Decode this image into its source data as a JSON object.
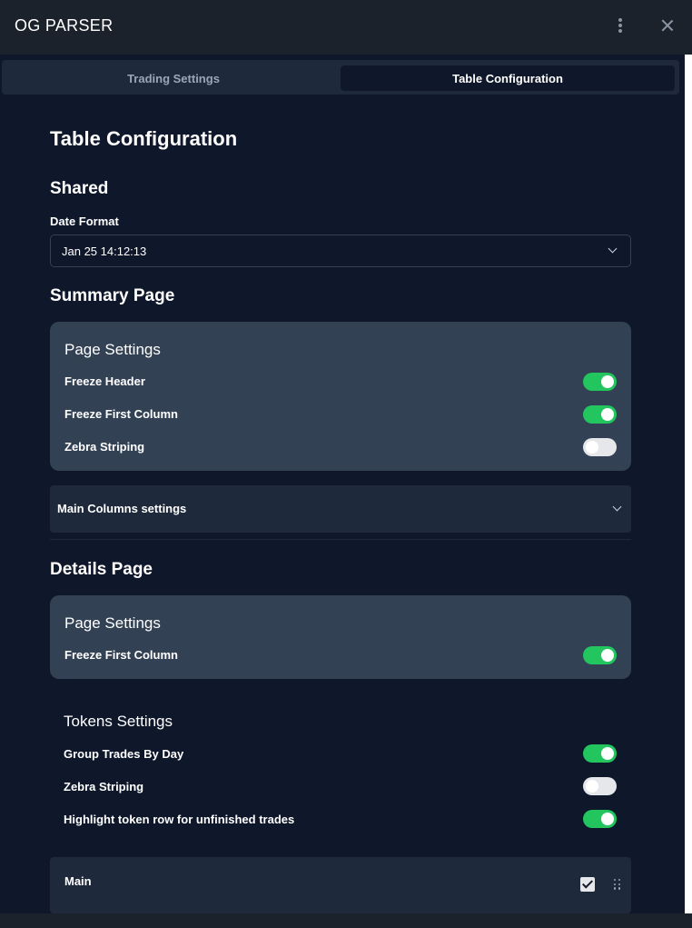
{
  "window": {
    "title": "OG PARSER"
  },
  "tabs": [
    {
      "label": "Trading Settings",
      "active": false
    },
    {
      "label": "Table Configuration",
      "active": true
    }
  ],
  "page": {
    "title": "Table Configuration"
  },
  "shared": {
    "heading": "Shared",
    "date_format_label": "Date Format",
    "date_format_value": "Jan 25 14:12:13"
  },
  "summary": {
    "heading": "Summary Page",
    "page_settings": {
      "title": "Page Settings",
      "rows": [
        {
          "label": "Freeze Header",
          "on": true
        },
        {
          "label": "Freeze First Column",
          "on": true
        },
        {
          "label": "Zebra Striping",
          "on": false
        }
      ]
    },
    "main_columns_label": "Main Columns settings"
  },
  "details": {
    "heading": "Details Page",
    "page_settings": {
      "title": "Page Settings",
      "rows": [
        {
          "label": "Freeze First Column",
          "on": true
        }
      ]
    },
    "tokens_settings": {
      "title": "Tokens Settings",
      "rows": [
        {
          "label": "Group Trades By Day",
          "on": true
        },
        {
          "label": "Zebra Striping",
          "on": false
        },
        {
          "label": "Highlight token row for unfinished trades",
          "on": true
        }
      ]
    },
    "main_item": {
      "label": "Main",
      "checked": true
    }
  },
  "colors": {
    "toggle_on": "#22c55e",
    "toggle_off": "#e5e7eb",
    "card_bg": "#334155",
    "panel_bg": "#0f172a",
    "titlebar_bg": "#1b222b"
  },
  "icons": [
    "kebab-menu-icon",
    "close-icon",
    "chevron-down-icon",
    "check-icon",
    "drag-handle-icon"
  ]
}
